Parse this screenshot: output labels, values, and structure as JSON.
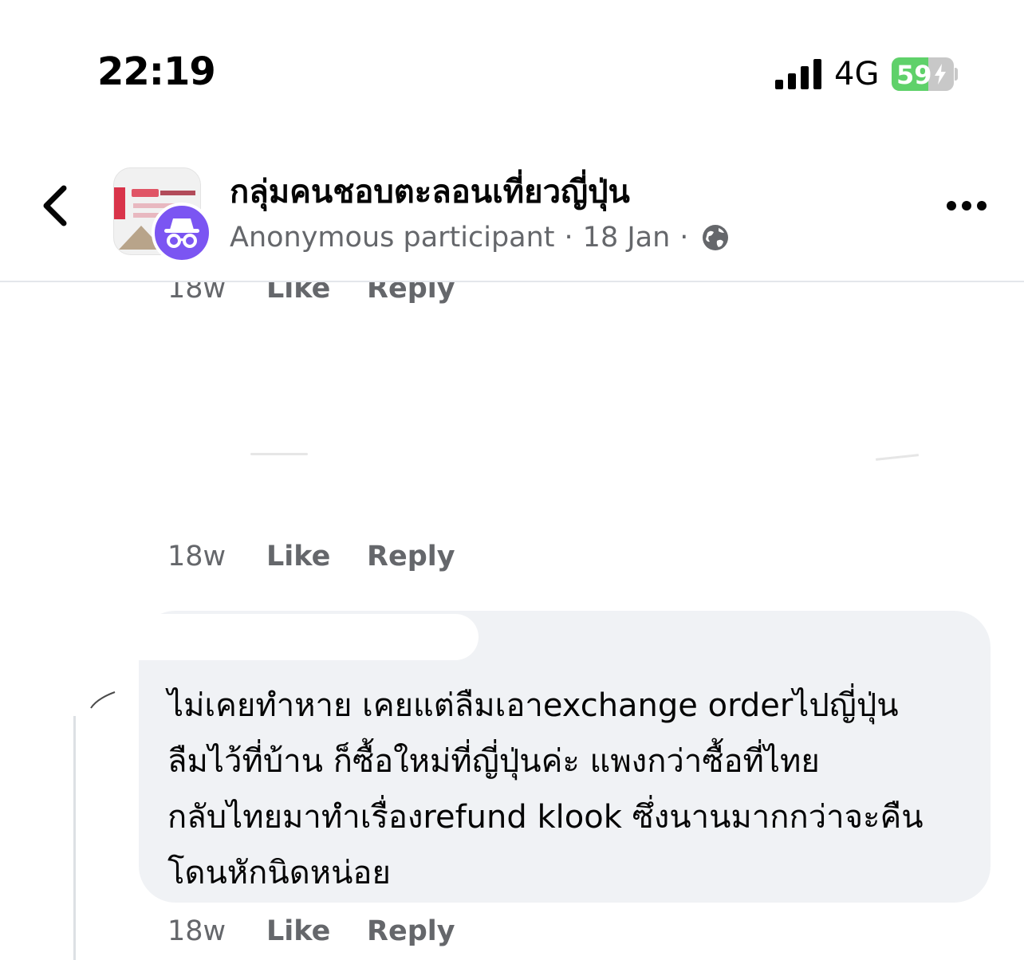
{
  "status_bar": {
    "time": "22:19",
    "network": "4G",
    "battery": "59",
    "battery_level": 0.59,
    "battery_color": "#5fd16a"
  },
  "header": {
    "group_name": "กลุ่มคนชอบตะลอนเที่ยวญี่ปุ่น",
    "author": "Anonymous participant",
    "date": "18 Jan",
    "separator": "·",
    "badge_color": "#7b55f2"
  },
  "comments": [
    {
      "time": "18w",
      "like": "Like",
      "reply": "Reply"
    },
    {
      "time": "18w",
      "like": "Like",
      "reply": "Reply"
    },
    {
      "text": "ไม่เคยทำหาย เคยแต่ลืมเอาexchange orderไปญี่ปุ่น ลืมไว้ที่บ้าน ก็ซื้อใหม่ที่ญี่ปุ่นค่ะ แพงกว่าซื้อที่ไทย กลับไทยมาทำเรื่องrefund klook ซึ่งนานมากกว่าจะคืน โดนหักนิดหน่อย",
      "lines": [
        "ไม่เคยทำหาย เคยแต่ลืมเอาexchange orderไปญี่ปุ่น",
        "ลืมไว้ที่บ้าน ก็ซื้อใหม่ที่ญี่ปุ่นค่ะ แพงกว่าซื้อที่ไทย",
        "กลับไทยมาทำเรื่องrefund klook ซึ่งนานมากกว่าจะคืน",
        "โดนหักนิดหน่อย"
      ],
      "time": "18w",
      "like": "Like",
      "reply": "Reply"
    }
  ],
  "icons": {
    "back": "chevron-left-icon",
    "more": "more-horizontal-icon",
    "privacy": "globe-icon",
    "anonymous": "incognito-icon"
  }
}
